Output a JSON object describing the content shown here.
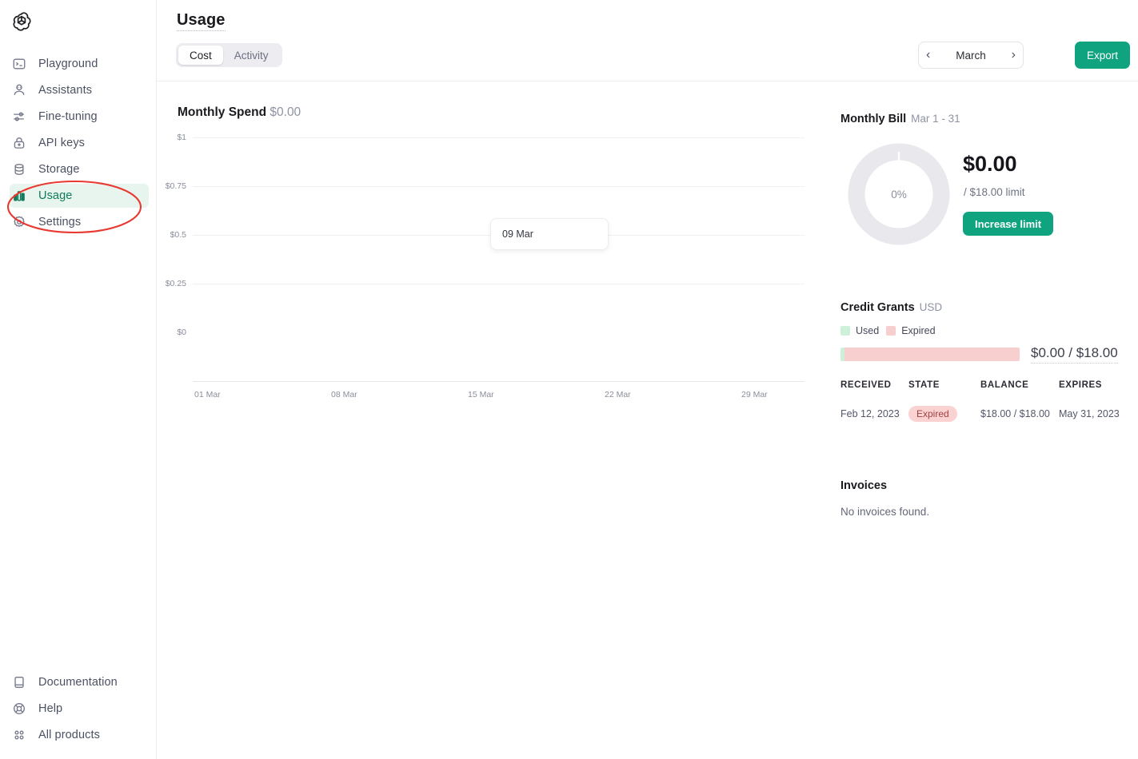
{
  "sidebar": {
    "logo_icon": "openai-logo-icon",
    "main_items": [
      {
        "label": "Playground",
        "icon": "playground-icon",
        "active": false
      },
      {
        "label": "Assistants",
        "icon": "assistants-robot-icon",
        "active": false
      },
      {
        "label": "Fine-tuning",
        "icon": "sliders-icon",
        "active": false
      },
      {
        "label": "API keys",
        "icon": "lock-icon",
        "active": false
      },
      {
        "label": "Storage",
        "icon": "database-icon",
        "active": false
      },
      {
        "label": "Usage",
        "icon": "bar-chart-icon",
        "active": true
      },
      {
        "label": "Settings",
        "icon": "gear-icon",
        "active": false
      }
    ],
    "bottom_items": [
      {
        "label": "Documentation",
        "icon": "book-icon"
      },
      {
        "label": "Help",
        "icon": "lifebuoy-icon"
      },
      {
        "label": "All products",
        "icon": "grid-dots-icon"
      }
    ]
  },
  "header": {
    "title": "Usage",
    "tabs": [
      {
        "label": "Cost",
        "selected": true
      },
      {
        "label": "Activity",
        "selected": false
      }
    ],
    "month": "March",
    "prev_icon": "chevron-left-icon",
    "next_icon": "chevron-right-icon",
    "export_label": "Export"
  },
  "chart_panel": {
    "title": "Monthly Spend",
    "amount": "$0.00",
    "tooltip": "09 Mar"
  },
  "chart_data": {
    "type": "bar",
    "title": "Monthly Spend",
    "xlabel": "",
    "ylabel": "",
    "categories": [
      "01 Mar",
      "08 Mar",
      "15 Mar",
      "22 Mar",
      "29 Mar"
    ],
    "x_tick_labels": [
      "01 Mar",
      "08 Mar",
      "15 Mar",
      "22 Mar",
      "29 Mar"
    ],
    "y_tick_labels": [
      "$1",
      "$0.75",
      "$0.5",
      "$0.25",
      "$0"
    ],
    "y_tick_values": [
      1,
      0.75,
      0.5,
      0.25,
      0
    ],
    "ylim": [
      0,
      1
    ],
    "values": [
      0,
      0,
      0,
      0,
      0
    ],
    "grid": true,
    "legend": "none",
    "hover_tooltip": {
      "label": "09 Mar",
      "value": ""
    },
    "note": "No spend recorded for March; all daily bars are $0.00"
  },
  "monthly_bill": {
    "heading": "Monthly Bill",
    "period": "Mar 1 - 31",
    "percent_label": "0%",
    "percent_value": 0,
    "amount": "$0.00",
    "limit_text": "/ $18.00 limit",
    "button_label": "Increase limit"
  },
  "credit_grants": {
    "heading": "Credit Grants",
    "currency": "USD",
    "legend": [
      {
        "label": "Used",
        "color": "#cdf0d8"
      },
      {
        "label": "Expired",
        "color": "#f8cfcf"
      }
    ],
    "bar": {
      "used_percent": 2,
      "expired_percent": 98
    },
    "amount": "$0.00 / $18.00",
    "columns": [
      "RECEIVED",
      "STATE",
      "BALANCE",
      "EXPIRES"
    ],
    "rows": [
      {
        "received": "Feb 12, 2023",
        "state": "Expired",
        "balance": "$18.00 / $18.00",
        "expires": "May 31, 2023"
      }
    ]
  },
  "invoices": {
    "heading": "Invoices",
    "empty_text": "No invoices found."
  },
  "annotation": {
    "shape": "ellipse",
    "target": "Usage",
    "color": "#e8382f"
  },
  "colors": {
    "accent_green": "#10a37f",
    "active_nav_bg": "#e8f5ef",
    "active_nav_text": "#0f7a5c",
    "used": "#cdf0d8",
    "expired": "#f8cfcf",
    "expired_text": "#a24040",
    "annotation_red": "#e8382f"
  }
}
